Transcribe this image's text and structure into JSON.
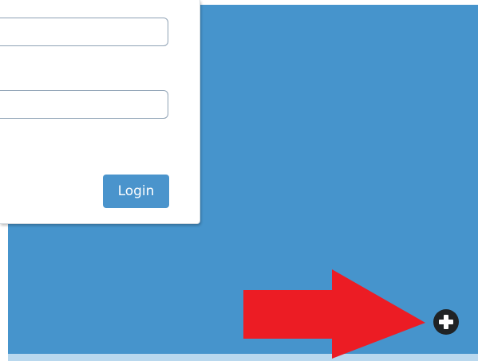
{
  "login_form": {
    "username_value": "",
    "password_value": "",
    "login_label": "Login"
  },
  "colors": {
    "background_panel": "#4694cc",
    "bottom_strip": "#b9d8ee",
    "login_button": "#4a94cc",
    "annotation_arrow": "#ec1c24",
    "add_button": "#202325"
  },
  "icons": {
    "add_button_icon": "plus-icon",
    "annotation": "arrow-right-icon"
  }
}
